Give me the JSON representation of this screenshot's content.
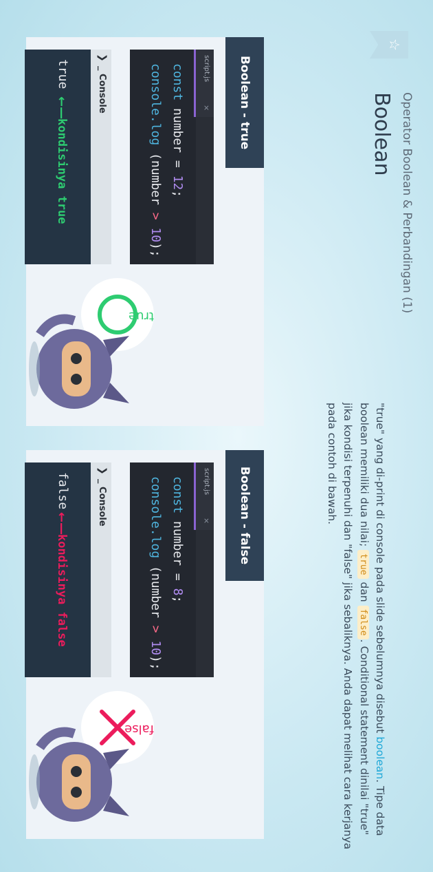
{
  "header": {
    "subtitle": "Operator Boolean & Perbandingan (1)",
    "title": "Boolean",
    "bookmark_icon": "star-icon"
  },
  "description": {
    "p1": "\"true\" yang di-print di console pada slide sebelumnya disebut ",
    "keyword": "boolean",
    "p2": ". Tipe data boolean memiliki dua nilai; ",
    "true_chip": "true",
    "p3": " dan ",
    "false_chip": "false",
    "p4": ". Conditional statement dinilai \"true\" jika kondisi terpenuhi dan \"false\" jika sebaliknya. Anda dapat melihat cara kerjanya pada contoh di bawah."
  },
  "panels": [
    {
      "title": "Boolean - true",
      "editor": {
        "tab": "script.js",
        "close": "×",
        "l1_kw": "const",
        "l1_rest": " number = ",
        "l1_num": "12",
        "l1_end": ";",
        "l2_fn": "console.log",
        "l2_a": " (number ",
        "l2_op": ">",
        "l2_b": " ",
        "l2_num": "10",
        "l2_end": ");"
      },
      "console": {
        "icon": "❯",
        "label": "_ Console",
        "value": "true",
        "arrow": "←—",
        "condition": "kondisinya  true"
      },
      "bubble": {
        "label": "true",
        "symbol": "circle-icon"
      }
    },
    {
      "title": "Boolean - false",
      "editor": {
        "tab": "script.js",
        "close": "×",
        "l1_kw": "const",
        "l1_rest": " number = ",
        "l1_num": "8",
        "l1_end": ";",
        "l2_fn": "console.log",
        "l2_a": " (number ",
        "l2_op": ">",
        "l2_b": " ",
        "l2_num": "10",
        "l2_end": ");"
      },
      "console": {
        "icon": "❯",
        "label": "_ Console",
        "value": "false",
        "arrow": "←—",
        "condition": "kondisinya  false"
      },
      "bubble": {
        "label": "false",
        "symbol": "cross-icon"
      }
    }
  ],
  "colors": {
    "true": "#2ecc71",
    "false": "#ec1c5c",
    "keyword": "#1fa8d8",
    "panel_title_bg": "#2f4256"
  }
}
